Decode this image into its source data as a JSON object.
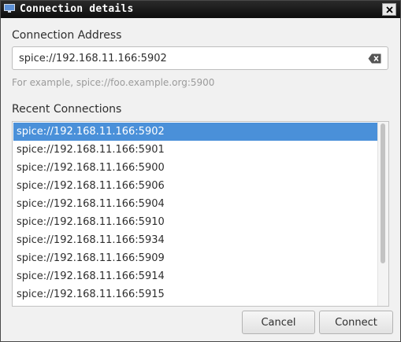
{
  "window": {
    "title": "Connection details"
  },
  "address": {
    "label": "Connection Address",
    "value": "spice://192.168.11.166:5902",
    "hint": "For example, spice://foo.example.org:5900"
  },
  "recent": {
    "label": "Recent Connections",
    "selected_index": 0,
    "items": [
      "spice://192.168.11.166:5902",
      "spice://192.168.11.166:5901",
      "spice://192.168.11.166:5900",
      "spice://192.168.11.166:5906",
      "spice://192.168.11.166:5904",
      "spice://192.168.11.166:5910",
      "spice://192.168.11.166:5934",
      "spice://192.168.11.166:5909",
      "spice://192.168.11.166:5914",
      "spice://192.168.11.166:5915"
    ]
  },
  "buttons": {
    "cancel": "Cancel",
    "connect": "Connect"
  },
  "colors": {
    "selection": "#4a90d9",
    "titlebar": "#0e0e0e"
  },
  "icons": {
    "app": "monitor-icon",
    "close": "close-icon",
    "clear": "clear-text-icon"
  }
}
